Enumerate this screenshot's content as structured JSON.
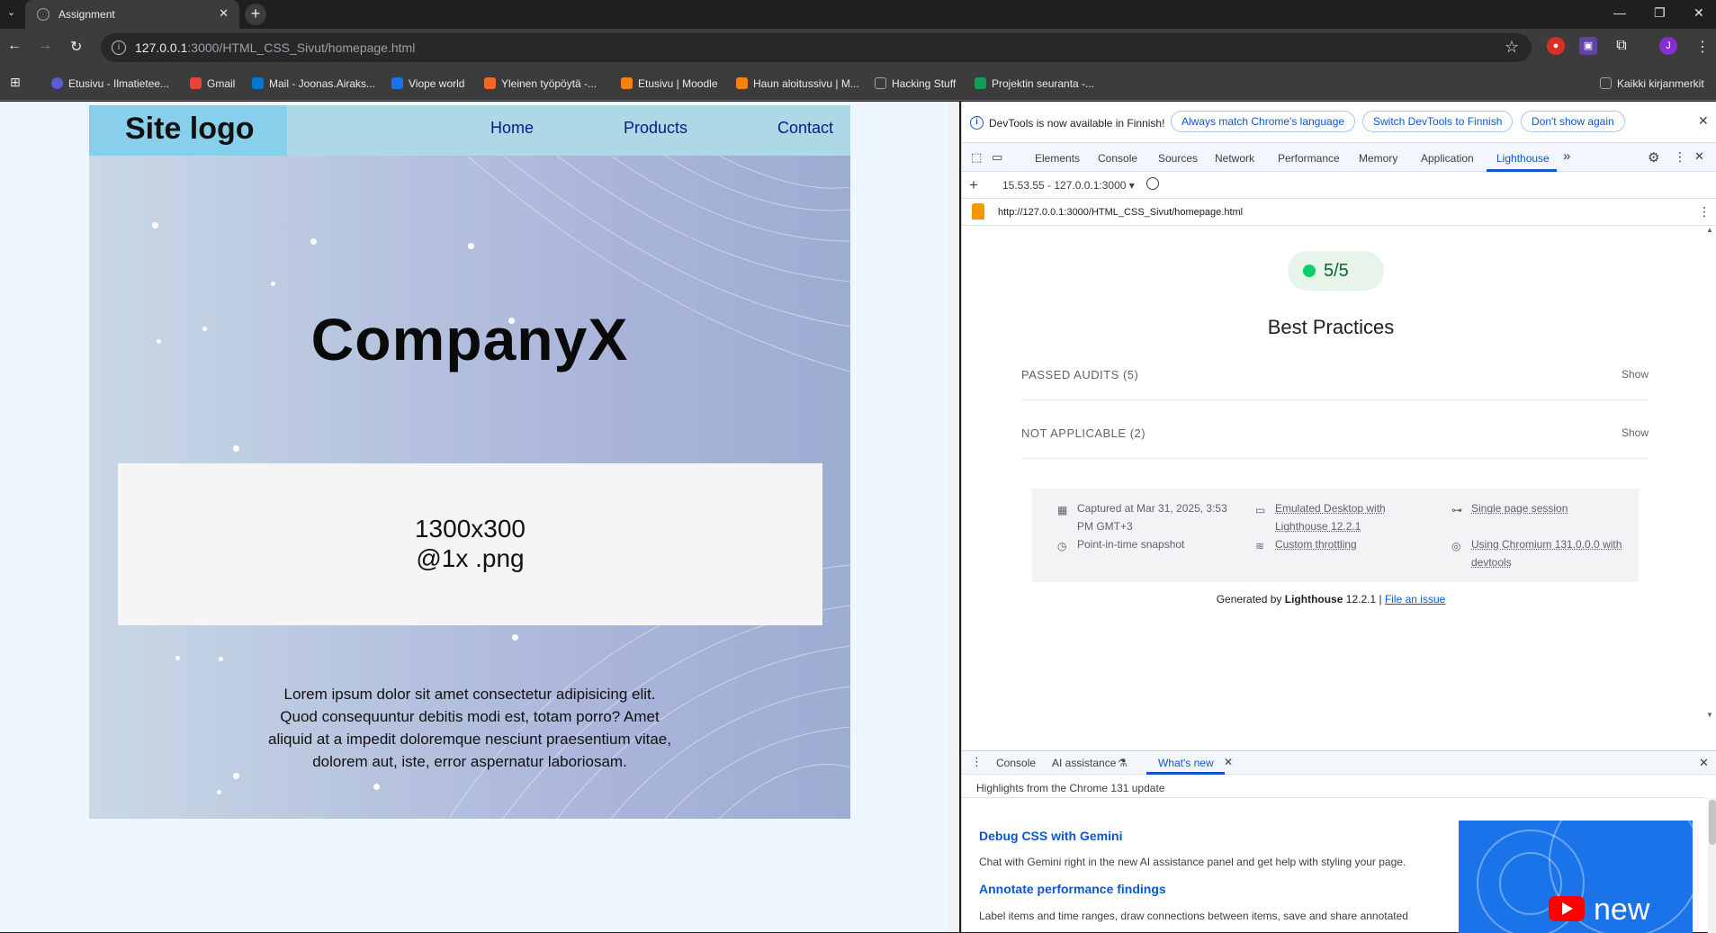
{
  "browser": {
    "tab_title": "Assignment",
    "tab_close": "✕",
    "new_tab": "+",
    "url_host": "127.0.0.1",
    "url_rest": ":3000/HTML_CSS_Sivut/homepage.html",
    "profile_initial": "J",
    "bookmarks": [
      {
        "label": "Etusivu - Ilmatietee...",
        "color": "#5b5bd6"
      },
      {
        "label": "Gmail",
        "color": "#ea4335"
      },
      {
        "label": "Mail - Joonas.Airaks...",
        "color": "#0078d4"
      },
      {
        "label": "Viope world",
        "color": "#1a73e8"
      },
      {
        "label": "Yleinen työpöytä -...",
        "color": "#f26722"
      },
      {
        "label": "Etusivu | Moodle",
        "color": "#f98012"
      },
      {
        "label": "Haun aloitussivu | M...",
        "color": "#f98012"
      },
      {
        "label": "Hacking Stuff",
        "color": "#9aa0a6"
      },
      {
        "label": "Projektin seuranta -...",
        "color": "#0f9d58"
      }
    ],
    "all_bookmarks": "Kaikki kirjanmerkit"
  },
  "site": {
    "logo": "Site logo",
    "nav": [
      "Home",
      "Products",
      "Contact"
    ],
    "hero_title": "CompanyX",
    "image_placeholder_line1": "1300x300",
    "image_placeholder_line2": "@1x .png",
    "body_text": "Lorem ipsum dolor sit amet consectetur adipisicing elit. Quod consequuntur debitis modi est, totam porro? Amet aliquid at a impedit doloremque nesciunt praesentium vitae, dolorem aut, iste, error aspernatur laboriosam."
  },
  "devtools": {
    "infobar_message": "DevTools is now available in Finnish!",
    "infobar_buttons": [
      "Always match Chrome's language",
      "Switch DevTools to Finnish",
      "Don't show again"
    ],
    "tabs": [
      "Elements",
      "Console",
      "Sources",
      "Network",
      "Performance",
      "Memory",
      "Application",
      "Lighthouse"
    ],
    "active_tab": "Lighthouse",
    "more_tabs": "»",
    "report_selector": "15.53.55 - 127.0.0.1:3000 ▾",
    "report_url": "http://127.0.0.1:3000/HTML_CSS_Sivut/homepage.html",
    "score": "5/5",
    "category": "Best Practices",
    "audit_groups": [
      {
        "name": "PASSED AUDITS",
        "count": "(5)",
        "action": "Show"
      },
      {
        "name": "NOT APPLICABLE",
        "count": "(2)",
        "action": "Show"
      }
    ],
    "meta": {
      "captured": "Captured at Mar 31, 2025, 3:53 PM GMT+3",
      "snapshot": "Point-in-time snapshot",
      "emulated": "Emulated Desktop with Lighthouse 12.2.1",
      "throttling": "Custom throttling",
      "session": "Single page session",
      "chromium": "Using Chromium 131.0.0.0 with devtools"
    },
    "footer_prefix": "Generated by",
    "footer_brand": "Lighthouse",
    "footer_version": "12.2.1 |",
    "footer_link": "File an issue",
    "drawer": {
      "tabs": [
        "Console",
        "AI assistance",
        "What's new"
      ],
      "active_tab": "What's new",
      "subtitle": "Highlights from the Chrome 131 update",
      "items": [
        {
          "title": "Debug CSS with Gemini",
          "desc": "Chat with Gemini right in the new AI assistance panel and get help with styling your page."
        },
        {
          "title": "Annotate performance findings",
          "desc": "Label items and time ranges, draw connections between items, save and share annotated"
        }
      ],
      "thumb_text": "new"
    }
  },
  "colors": {
    "accent": "#0b57d0",
    "score_green": "#0cce6b",
    "site_header": "#add8e6",
    "site_logo_bg": "#87cfea"
  }
}
